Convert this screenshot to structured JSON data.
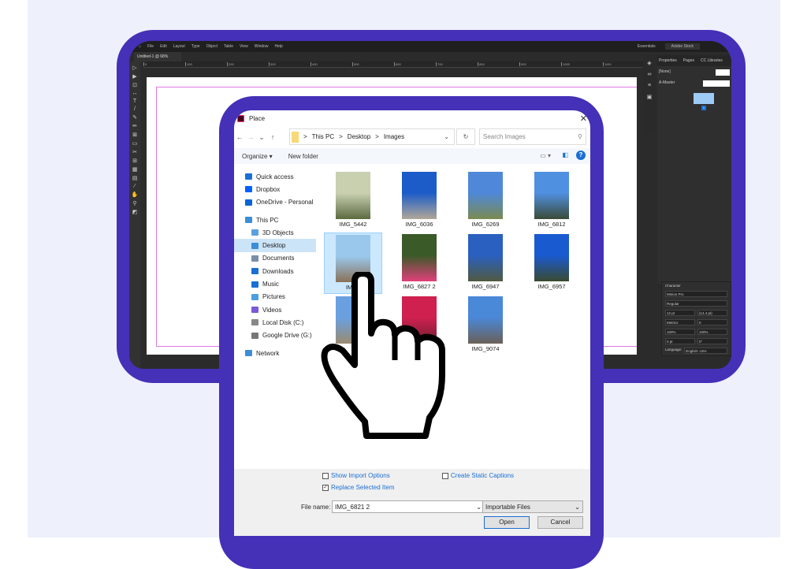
{
  "app": {
    "menu": [
      "File",
      "Edit",
      "Layout",
      "Type",
      "Object",
      "Table",
      "View",
      "Window",
      "Help"
    ],
    "doc_tab": "Untitled-1 @ 68%",
    "workspace": "Essentials",
    "search_placeholder": "Adobe Stock",
    "ruler": [
      "0",
      "100",
      "200",
      "300",
      "400",
      "500",
      "600",
      "700",
      "800",
      "900",
      "1000",
      "1100"
    ],
    "panel_tabs": [
      "Properties",
      "Pages",
      "CC Libraries"
    ],
    "pages_rows": [
      "[None]",
      "A-Master"
    ],
    "page_number": "1",
    "character": {
      "title": "Character",
      "font": "Minion Pro",
      "style": "Regular",
      "size": "12 pt",
      "leading": "(14.4 pt)",
      "kerning": "Metrics",
      "tracking": "0",
      "vscale": "100%",
      "hscale": "100%",
      "baseline": "0 pt",
      "skew": "0°",
      "language_label": "Language:",
      "language": "English: USA"
    }
  },
  "dialog": {
    "title": "Place",
    "breadcrumb": [
      "This PC",
      "Desktop",
      "Images"
    ],
    "search_placeholder": "Search Images",
    "organize": "Organize ▾",
    "new_folder": "New folder",
    "sidebar": [
      {
        "label": "Quick access",
        "icon": "star-icon",
        "color": "#1a6fd4"
      },
      {
        "label": "Dropbox",
        "icon": "dropbox-icon",
        "color": "#0061fe"
      },
      {
        "label": "OneDrive - Personal",
        "icon": "cloud-icon",
        "color": "#0a64d8"
      },
      {
        "label": "This PC",
        "icon": "computer-icon",
        "color": "#3b8ed8"
      },
      {
        "label": "3D Objects",
        "icon": "cube-icon",
        "color": "#5aa0e0",
        "sub": true
      },
      {
        "label": "Desktop",
        "icon": "desktop-icon",
        "color": "#3b8ed8",
        "sub": true,
        "selected": true
      },
      {
        "label": "Documents",
        "icon": "document-icon",
        "color": "#7a8ea8",
        "sub": true
      },
      {
        "label": "Downloads",
        "icon": "download-icon",
        "color": "#1a6fd4",
        "sub": true
      },
      {
        "label": "Music",
        "icon": "music-icon",
        "color": "#1a6fd4",
        "sub": true
      },
      {
        "label": "Pictures",
        "icon": "pictures-icon",
        "color": "#4aa0e0",
        "sub": true
      },
      {
        "label": "Videos",
        "icon": "video-icon",
        "color": "#7a5ad8",
        "sub": true
      },
      {
        "label": "Local Disk (C:)",
        "icon": "disk-icon",
        "color": "#888",
        "sub": true
      },
      {
        "label": "Google Drive (G:)",
        "icon": "disk-icon",
        "color": "#777",
        "sub": true
      },
      {
        "label": "Network",
        "icon": "network-icon",
        "color": "#3b8ed8"
      }
    ],
    "files": [
      {
        "name": "IMG_5442",
        "c1": "#c8d0b0",
        "c2": "#5c6a40"
      },
      {
        "name": "IMG_6036",
        "c1": "#1c5cc8",
        "c2": "#b0a898"
      },
      {
        "name": "IMG_6269",
        "c1": "#4f88d8",
        "c2": "#7a8a50"
      },
      {
        "name": "IMG_6812",
        "c1": "#5090e0",
        "c2": "#3a4a38"
      },
      {
        "name": "IMG_",
        "c1": "#9ac8ec",
        "c2": "#8a7058",
        "selected": true
      },
      {
        "name": "IMG_6827 2",
        "c1": "#3a5a28",
        "c2": "#e0407a"
      },
      {
        "name": "IMG_6947",
        "c1": "#2a60c0",
        "c2": "#505a40"
      },
      {
        "name": "IMG_6957",
        "c1": "#1a5ad0",
        "c2": "#3a4a30"
      },
      {
        "name": "",
        "c1": "#6aa0e0",
        "c2": "#9a8a70"
      },
      {
        "name": "",
        "c1": "#d02050",
        "c2": "#6a2030"
      },
      {
        "name": "IMG_9074",
        "c1": "#4a88d8",
        "c2": "#6a6058"
      }
    ],
    "show_import_options": "Show Import Options",
    "replace_selected": "Replace Selected Item",
    "create_static_captions": "Create Static Captions",
    "file_name_label": "File name:",
    "file_name": "IMG_6821 2",
    "file_type": "Importable Files",
    "open": "Open",
    "cancel": "Cancel"
  },
  "colors": {
    "frame": "#4530b8",
    "selection": "#cce4f7",
    "link": "#1a6fd4"
  }
}
